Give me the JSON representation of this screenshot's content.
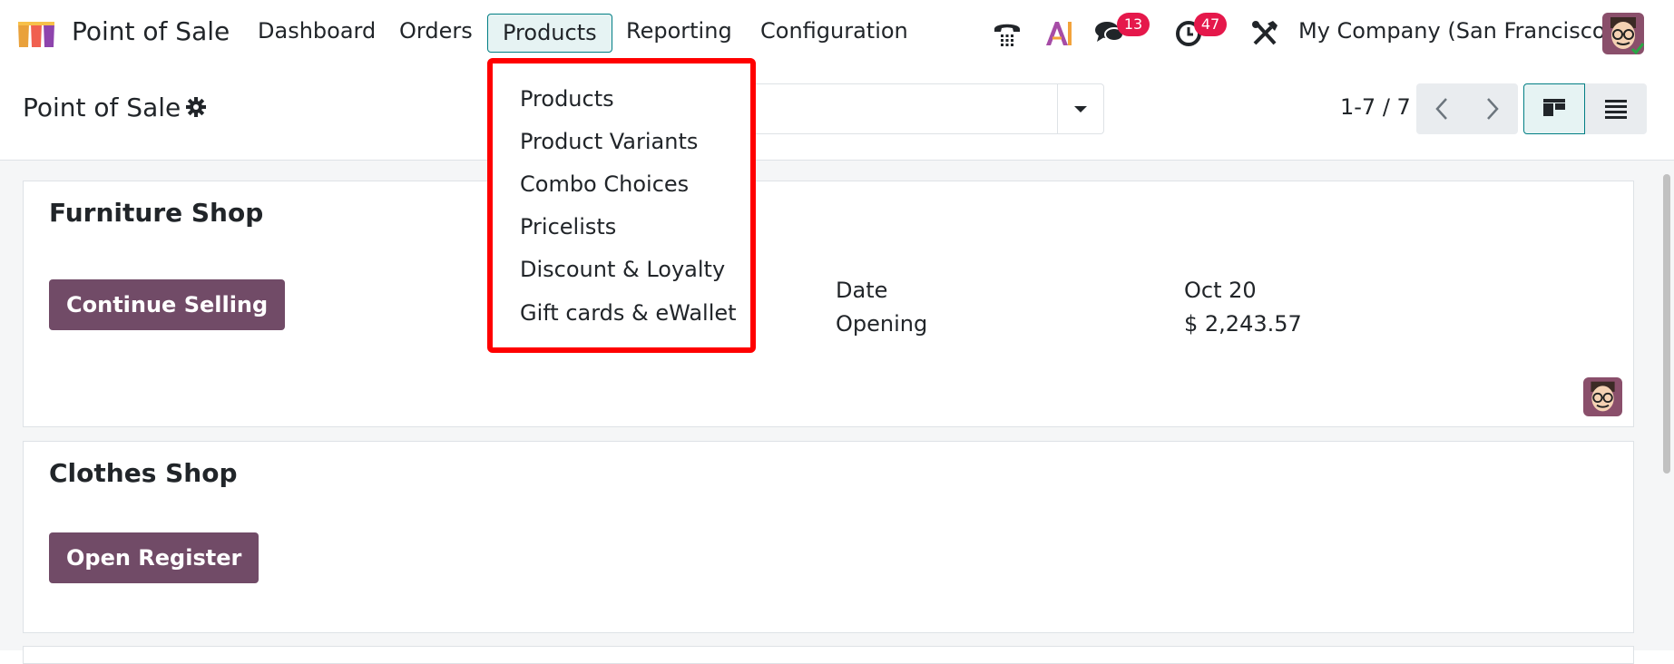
{
  "navbar": {
    "app_title": "Point of Sale",
    "menu": [
      "Dashboard",
      "Orders",
      "Products",
      "Reporting",
      "Configuration"
    ],
    "active_menu": "Products",
    "messages_count": "13",
    "activities_count": "47",
    "company": "My Company (San Francisco)"
  },
  "control_panel": {
    "title": "Point of Sale",
    "pager": "1-7 / 7"
  },
  "products_menu": {
    "items": [
      "Products",
      "Product Variants",
      "Combo Choices",
      "Pricelists",
      "Discount & Loyalty",
      "Gift cards & eWallet"
    ]
  },
  "cards": [
    {
      "title": "Furniture Shop",
      "button": "Continue Selling",
      "date_label": "Date",
      "date_value": "Oct 20",
      "opening_label": "Opening",
      "opening_value": "$ 2,243.57"
    },
    {
      "title": "Clothes Shop",
      "button": "Open Register"
    }
  ],
  "colors": {
    "brand": "#714b67",
    "accent": "#017e84",
    "badge": "#e5184b",
    "highlight_border": "#ff0000"
  },
  "icons": [
    "pos-logo",
    "phone-icon",
    "ai-icon",
    "chat-icon",
    "clock-icon",
    "tools-icon",
    "gear-icon",
    "caret-down-icon",
    "chevron-left-icon",
    "chevron-right-icon",
    "kanban-view-icon",
    "list-view-icon"
  ]
}
